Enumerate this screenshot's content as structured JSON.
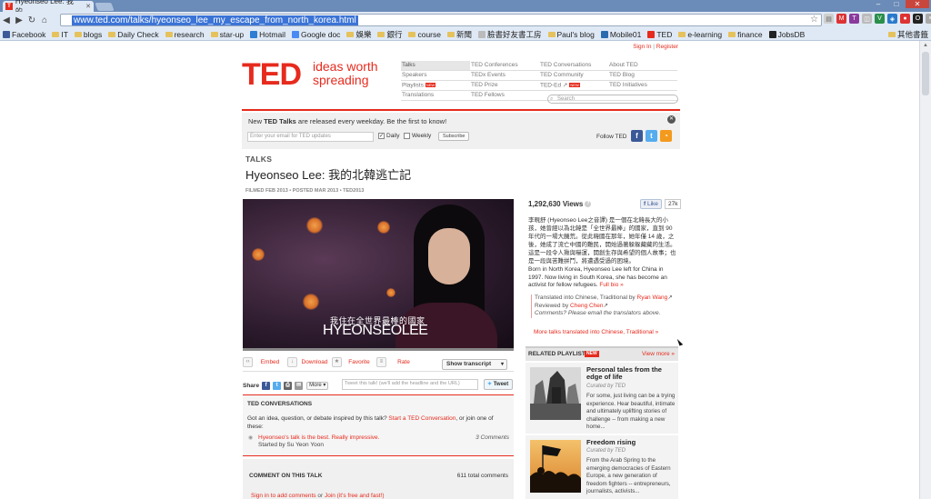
{
  "browser": {
    "tab_title": "Hyeonseo Lee: 我的...",
    "url": "www.ted.com/talks/hyeonseo_lee_my_escape_from_north_korea.html",
    "bookmarks": [
      {
        "label": "Facebook",
        "icon": "facebook-icon"
      },
      {
        "label": "IT",
        "icon": "folder-icon"
      },
      {
        "label": "blogs",
        "icon": "folder-icon"
      },
      {
        "label": "Daily Check",
        "icon": "folder-icon"
      },
      {
        "label": "research",
        "icon": "folder-icon"
      },
      {
        "label": "star-up",
        "icon": "folder-icon"
      },
      {
        "label": "Hotmail",
        "icon": "hotmail-icon"
      },
      {
        "label": "Google doc",
        "icon": "google-docs-icon"
      },
      {
        "label": "娛樂",
        "icon": "folder-icon"
      },
      {
        "label": "銀行",
        "icon": "folder-icon"
      },
      {
        "label": "course",
        "icon": "folder-icon"
      },
      {
        "label": "新聞",
        "icon": "folder-icon"
      },
      {
        "label": "臉書好友書工房",
        "icon": "page-icon"
      },
      {
        "label": "Paul's blog",
        "icon": "folder-icon"
      },
      {
        "label": "Mobile01",
        "icon": "mobile01-icon"
      },
      {
        "label": "TED",
        "icon": "ted-icon"
      },
      {
        "label": "e-learning",
        "icon": "folder-icon"
      },
      {
        "label": "finance",
        "icon": "folder-icon"
      },
      {
        "label": "JobsDB",
        "icon": "jobsdb-icon"
      }
    ],
    "other_bookmarks": "其他書籤"
  },
  "header": {
    "sign_in": "Sign In",
    "separator": "|",
    "register": "Register",
    "logo": "TED",
    "tagline": "ideas worth spreading",
    "nav": [
      [
        "Talks",
        "Speakers",
        "Playlists",
        "Translations"
      ],
      [
        "TED Conferences",
        "TEDx Events",
        "TED Prize",
        "TED Fellows"
      ],
      [
        "TED Conversations",
        "TED Community",
        "TED-Ed",
        ""
      ],
      [
        "About TED",
        "TED Blog",
        "TED Initiatives",
        ""
      ]
    ],
    "new_label": "NEW",
    "search_placeholder": "Search"
  },
  "promo": {
    "message_pre": "New ",
    "message_bold": "TED Talks",
    "message_post": " are released every weekday. Be the first to know!",
    "email_placeholder": "Enter your email for TED updates",
    "daily": "Daily",
    "weekly": "Weekly",
    "subscribe": "Subscribe",
    "follow": "Follow TED"
  },
  "talk": {
    "section": "TALKS",
    "title": "Hyeonseo Lee: 我的北韓逃亡記",
    "meta": "FILMED FEB 2013 • POSTED MAR 2013 • TED2013",
    "subtitle_zh": "我住在全世界最棒的國家",
    "speaker_overlay": "HYEONSEOLEE",
    "actions": [
      "Embed",
      "Download",
      "Favorite",
      "Rate"
    ],
    "show_transcript": "Show transcript",
    "share_label": "Share",
    "more_label": "More",
    "tweet_placeholder": "Tweet this talk! (we'll add the headline and the URL)",
    "tweet_button": "Tweet"
  },
  "conversations": {
    "heading": "TED CONVERSATIONS",
    "prompt_pre": "Got an idea, question, or debate inspired by this talk? ",
    "prompt_link": "Start a TED Conversation",
    "prompt_post": ", or join one of these:",
    "item_title": "Hyeonseo's talk is the best. Really impressive.",
    "item_author": "Started by Su Yeon Yoon",
    "item_count": "3 Comments"
  },
  "comments": {
    "heading": "COMMENT ON THIS TALK",
    "total": "611 total comments",
    "signin_link": "Sign in to add comments",
    "or": " or ",
    "join_link": "Join (it's free and fast!)"
  },
  "sidebar": {
    "views": "1,292,630 Views",
    "like": "Like",
    "like_count": "27k",
    "description_zh": "李晛舒 (Hyeonseo Lee之音譯) 是一個在北韓長大的小孩，她曾經以為北韓是「全世界最棒」的國家，直到 90 年代的一場大饑荒。從此韓國在那年，她年僅 14 歲，之後，她成了流亡中國的難民，開始過著躲躲藏藏的生活。這是一段令人揪與嚇運，開創生存與希望的個人故事；也是一段與苦難拼鬥，將遭遇受過的困境。",
    "description_en": "Born in North Korea, Hyeonseo Lee left for China in 1997. Now living in South Korea, she has become an activist for fellow refugees.",
    "full_bio": "Full bio »",
    "translated_pre": "Translated into Chinese, Traditional by ",
    "translator": "Ryan Wang",
    "reviewed_pre": "Reviewed by ",
    "reviewer": "Cheng Chen",
    "comments_q": "Comments? Please email the translators above.",
    "more_translated": "More talks translated into Chinese, Traditional »",
    "related_heading": "RELATED PLAYLISTS",
    "related_new": "NEW",
    "view_more": "View more »",
    "playlists": [
      {
        "title": "Personal tales from the edge of life",
        "curated": "Curated by TED",
        "desc": "For some, just living can be a trying experience. Hear beautiful, intimate and ultimately uplifting stories of challenge -- from making a new home..."
      },
      {
        "title": "Freedom rising",
        "curated": "Curated by TED",
        "desc": "From the Arab Spring to the emerging democracies of Eastern Europe, a new generation of freedom fighters -- entrepreneurs, journalists, activists..."
      }
    ]
  },
  "colors": {
    "ted_red": "#e62b1e",
    "chrome": "#dfe9f5"
  }
}
